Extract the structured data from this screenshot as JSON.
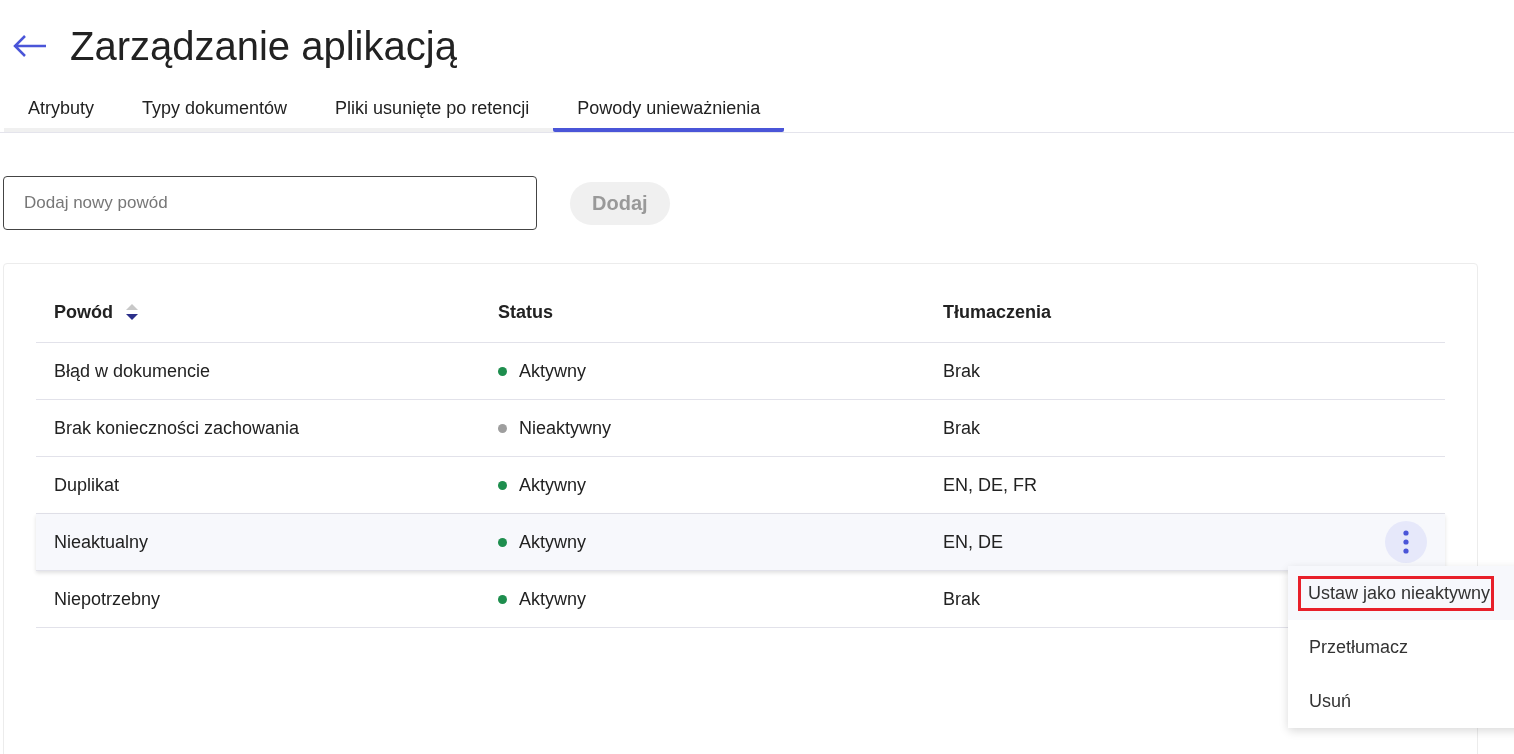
{
  "header": {
    "title": "Zarządzanie aplikacją"
  },
  "tabs": [
    {
      "label": "Atrybuty",
      "selected": false
    },
    {
      "label": "Typy dokumentów",
      "selected": false
    },
    {
      "label": "Pliki usunięte po retencji",
      "selected": false
    },
    {
      "label": "Powody unieważnienia",
      "selected": true
    }
  ],
  "add_form": {
    "placeholder": "Dodaj nowy powód",
    "button": {
      "label": "Dodaj",
      "disabled": true
    }
  },
  "table": {
    "columns": [
      {
        "label": "Powód",
        "sortable": true
      },
      {
        "label": "Status",
        "sortable": false
      },
      {
        "label": "Tłumaczenia",
        "sortable": false
      }
    ],
    "rows": [
      {
        "reason": "Błąd w dokumencie",
        "status": "Aktywny",
        "color": "#1e8e4e",
        "translations": "Brak",
        "hovered": false
      },
      {
        "reason": "Brak konieczności zachowania",
        "status": "Nieaktywny",
        "color": "#9e9e9e",
        "translations": "Brak",
        "hovered": false
      },
      {
        "reason": "Duplikat",
        "status": "Aktywny",
        "color": "#1e8e4e",
        "translations": "EN, DE, FR",
        "hovered": false
      },
      {
        "reason": "Nieaktualny",
        "status": "Aktywny",
        "color": "#1e8e4e",
        "translations": "EN, DE",
        "hovered": true
      },
      {
        "reason": "Niepotrzebny",
        "status": "Aktywny",
        "color": "#1e8e4e",
        "translations": "Brak",
        "hovered": false
      }
    ]
  },
  "context_menu": {
    "items": [
      {
        "label": "Ustaw jako nieaktywny",
        "highlighted": true
      },
      {
        "label": "Przetłumacz",
        "highlighted": false
      },
      {
        "label": "Usuń",
        "highlighted": false
      }
    ]
  }
}
